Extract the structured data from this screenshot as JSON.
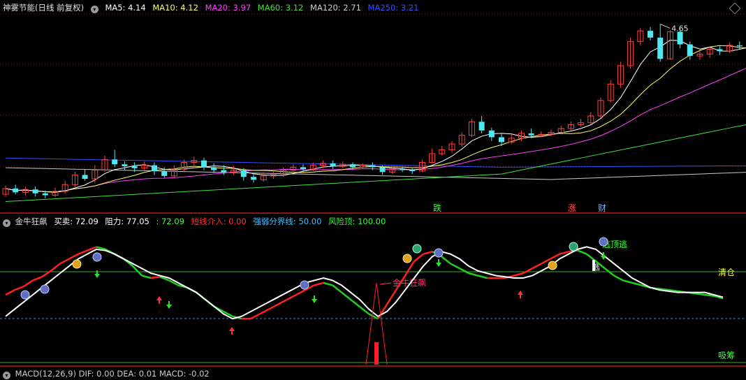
{
  "main_header": {
    "title": "神雾节能(日线 前复权)",
    "ma": [
      {
        "label": "MA5: 4.14",
        "color": "#ffffff"
      },
      {
        "label": "MA10: 4.12",
        "color": "#ffff66"
      },
      {
        "label": "MA20: 3.97",
        "color": "#ff40ff"
      },
      {
        "label": "MA60: 3.12",
        "color": "#40e040"
      },
      {
        "label": "MA120: 2.71",
        "color": "#d0d0d0"
      },
      {
        "label": "MA250: 3.21",
        "color": "#3050ff"
      }
    ]
  },
  "price_chart": {
    "high_marker": "4.65",
    "tags": [
      {
        "text": "跌",
        "color": "#40ff40"
      },
      {
        "text": "涨",
        "color": "#ff5050"
      },
      {
        "text": "财",
        "color": "#80b0ff"
      }
    ],
    "candles": [
      [
        3.2,
        3.32,
        3.38,
        3.15
      ],
      [
        3.32,
        3.24,
        3.4,
        3.2
      ],
      [
        3.24,
        3.3,
        3.36,
        3.18
      ],
      [
        3.3,
        3.22,
        3.36,
        3.16
      ],
      [
        3.22,
        3.18,
        3.28,
        3.12
      ],
      [
        3.18,
        3.26,
        3.34,
        3.14
      ],
      [
        3.26,
        3.4,
        3.48,
        3.22
      ],
      [
        3.4,
        3.6,
        3.66,
        3.36
      ],
      [
        3.6,
        3.52,
        3.72,
        3.48
      ],
      [
        3.52,
        3.7,
        3.8,
        3.44
      ],
      [
        3.7,
        3.92,
        4.0,
        3.66
      ],
      [
        3.92,
        3.82,
        4.12,
        3.76
      ],
      [
        3.82,
        3.78,
        3.88,
        3.7
      ],
      [
        3.78,
        3.74,
        3.86,
        3.66
      ],
      [
        3.74,
        3.8,
        3.88,
        3.7
      ],
      [
        3.8,
        3.68,
        3.86,
        3.6
      ],
      [
        3.68,
        3.58,
        3.76,
        3.54
      ],
      [
        3.58,
        3.72,
        3.8,
        3.54
      ],
      [
        3.72,
        3.86,
        3.92,
        3.68
      ],
      [
        3.86,
        3.9,
        3.98,
        3.8
      ],
      [
        3.9,
        3.76,
        3.96,
        3.7
      ],
      [
        3.76,
        3.7,
        3.84,
        3.64
      ],
      [
        3.7,
        3.66,
        3.8,
        3.6
      ],
      [
        3.66,
        3.7,
        3.78,
        3.6
      ],
      [
        3.7,
        3.56,
        3.74,
        3.48
      ],
      [
        3.56,
        3.5,
        3.62,
        3.44
      ],
      [
        3.5,
        3.58,
        3.66,
        3.46
      ],
      [
        3.58,
        3.62,
        3.7,
        3.52
      ],
      [
        3.62,
        3.7,
        3.76,
        3.56
      ],
      [
        3.7,
        3.76,
        3.82,
        3.64
      ],
      [
        3.76,
        3.72,
        3.82,
        3.66
      ],
      [
        3.72,
        3.8,
        3.86,
        3.68
      ],
      [
        3.8,
        3.84,
        3.9,
        3.74
      ],
      [
        3.84,
        3.78,
        3.9,
        3.72
      ],
      [
        3.78,
        3.82,
        3.88,
        3.74
      ],
      [
        3.82,
        3.76,
        3.86,
        3.7
      ],
      [
        3.76,
        3.8,
        3.84,
        3.72
      ],
      [
        3.8,
        3.76,
        3.86,
        3.7
      ],
      [
        3.76,
        3.66,
        3.8,
        3.6
      ],
      [
        3.66,
        3.72,
        3.78,
        3.62
      ],
      [
        3.72,
        3.7,
        3.76,
        3.66
      ],
      [
        3.7,
        3.68,
        3.74,
        3.62
      ],
      [
        3.68,
        3.86,
        3.92,
        3.66
      ],
      [
        3.86,
        4.04,
        4.14,
        3.84
      ],
      [
        4.04,
        4.12,
        4.2,
        4.0
      ],
      [
        4.12,
        4.24,
        4.3,
        4.06
      ],
      [
        4.24,
        4.42,
        4.48,
        4.18
      ],
      [
        4.42,
        4.7,
        4.76,
        4.38
      ],
      [
        4.7,
        4.52,
        4.82,
        4.46
      ],
      [
        4.52,
        4.38,
        4.58,
        4.3
      ],
      [
        4.38,
        4.28,
        4.46,
        4.2
      ],
      [
        4.28,
        4.36,
        4.44,
        4.24
      ],
      [
        4.36,
        4.46,
        4.52,
        4.3
      ],
      [
        4.46,
        4.42,
        4.56,
        4.36
      ],
      [
        4.42,
        4.44,
        4.5,
        4.38
      ],
      [
        4.44,
        4.48,
        4.54,
        4.4
      ],
      [
        4.48,
        4.56,
        4.62,
        4.44
      ],
      [
        4.56,
        4.64,
        4.7,
        4.52
      ],
      [
        4.64,
        4.68,
        4.76,
        4.6
      ],
      [
        4.68,
        4.82,
        4.9,
        4.64
      ],
      [
        4.82,
        5.14,
        5.2,
        4.78
      ],
      [
        5.14,
        5.48,
        5.56,
        5.1
      ],
      [
        5.48,
        5.86,
        5.94,
        5.4
      ],
      [
        5.86,
        6.36,
        6.44,
        5.8
      ],
      [
        6.36,
        6.58,
        6.64,
        6.28
      ],
      [
        6.58,
        6.44,
        6.66,
        6.38
      ],
      [
        6.44,
        6.0,
        6.72,
        5.94
      ],
      [
        6.0,
        6.56,
        6.6,
        5.98
      ],
      [
        6.56,
        6.3,
        6.64,
        6.22
      ],
      [
        6.3,
        6.06,
        6.36,
        5.98
      ],
      [
        6.06,
        6.1,
        6.16,
        5.98
      ],
      [
        6.1,
        6.2,
        6.24,
        6.02
      ],
      [
        6.2,
        6.16,
        6.26,
        6.08
      ],
      [
        6.16,
        6.28,
        6.34,
        6.12
      ],
      [
        6.28,
        6.26,
        6.36,
        6.2
      ],
      [
        6.26,
        6.32,
        6.48,
        6.22
      ],
      [
        6.32,
        6.3,
        6.38,
        6.24
      ],
      [
        6.3,
        6.26,
        6.42,
        6.2
      ],
      [
        6.26,
        6.16,
        6.3,
        6.1
      ],
      [
        6.16,
        6.1,
        6.2,
        6.04
      ]
    ]
  },
  "indicator_header": {
    "title": "金牛狂飙",
    "items": [
      {
        "label": "买卖: 72.09",
        "color": "#ffffff"
      },
      {
        "label": "阻力: 77.05",
        "color": "#ffffff"
      },
      {
        "label": ": 72.09",
        "color": "#40ff40"
      },
      {
        "label": "短线介入: 0.00",
        "color": "#ff3030"
      },
      {
        "label": "强弱分界线: 50.00",
        "color": "#40c0ff"
      },
      {
        "label": "风险顶: 100.00",
        "color": "#40ff40"
      }
    ]
  },
  "indicator": {
    "level_top_label": "清仓",
    "level_bottom_label": "吸筹",
    "annotation_1": "金牛狂飙",
    "annotation_2": "逃顶逃",
    "annotation_3": "逃",
    "lines": {
      "buy_sell": [
        58,
        62,
        65,
        70,
        73,
        78,
        84,
        88,
        92,
        95,
        98,
        96,
        92,
        88,
        82,
        74,
        72,
        73,
        70,
        66,
        64,
        60,
        54,
        48,
        44,
        40,
        38,
        38,
        42,
        46,
        50,
        54,
        58,
        62,
        66,
        68,
        66,
        60,
        54,
        48,
        42,
        38,
        50,
        62,
        74,
        86,
        92,
        94,
        90,
        84,
        80,
        76,
        74,
        72,
        72,
        72,
        74,
        76,
        80,
        84,
        88,
        92,
        94,
        95,
        92,
        86,
        80,
        74,
        70,
        68,
        66,
        64,
        63,
        62,
        61,
        60,
        59,
        58,
        57,
        55
      ],
      "resistance": [
        40,
        46,
        52,
        58,
        64,
        70,
        76,
        82,
        88,
        92,
        96,
        95,
        92,
        88,
        84,
        80,
        76,
        74,
        72,
        68,
        64,
        60,
        54,
        48,
        42,
        38,
        40,
        44,
        48,
        52,
        56,
        60,
        64,
        68,
        70,
        72,
        70,
        66,
        60,
        54,
        46,
        40,
        44,
        52,
        62,
        72,
        82,
        90,
        94,
        92,
        88,
        82,
        78,
        76,
        74,
        73,
        72,
        72,
        74,
        78,
        82,
        88,
        92,
        96,
        98,
        96,
        90,
        84,
        78,
        72,
        68,
        64,
        62,
        61,
        60,
        60,
        60,
        60,
        58,
        56
      ]
    }
  },
  "macd_header": {
    "text": "MACD(12,26,9)  DIF: 0.00  DEA: 0.01  MACD: -0.02"
  }
}
